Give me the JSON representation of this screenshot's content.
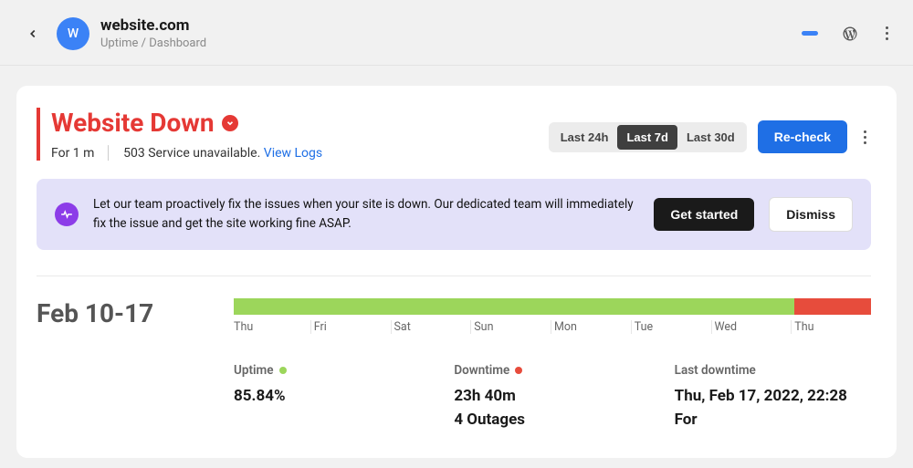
{
  "header": {
    "avatar_initial": "W",
    "site_title": "website.com",
    "breadcrumb": "Uptime / Dashboard"
  },
  "status": {
    "heading": "Website Down",
    "duration": "For 1 m",
    "error": "503 Service unavailable.",
    "view_logs": "View Logs"
  },
  "time_ranges": {
    "h24": "Last 24h",
    "d7": "Last 7d",
    "d30": "Last 30d",
    "selected": "d7"
  },
  "actions": {
    "recheck": "Re-check"
  },
  "banner": {
    "text": "Let our team proactively fix the issues when your site is down. Our dedicated team will immediately fix the issue and get the site working fine ASAP.",
    "get_started": "Get started",
    "dismiss": "Dismiss"
  },
  "timeline": {
    "range_label": "Feb 10-17",
    "ticks": [
      "Thu",
      "Fri",
      "Sat",
      "Sun",
      "Mon",
      "Tue",
      "Wed",
      "Thu"
    ],
    "up_pct": 88,
    "down_pct": 12
  },
  "metrics": {
    "uptime_label": "Uptime",
    "uptime_value": "85.84%",
    "downtime_label": "Downtime",
    "downtime_value": "23h 40m",
    "outages_value": "4 Outages",
    "last_label": "Last downtime",
    "last_value": "Thu, Feb 17, 2022, 22:28",
    "last_for": "For"
  }
}
